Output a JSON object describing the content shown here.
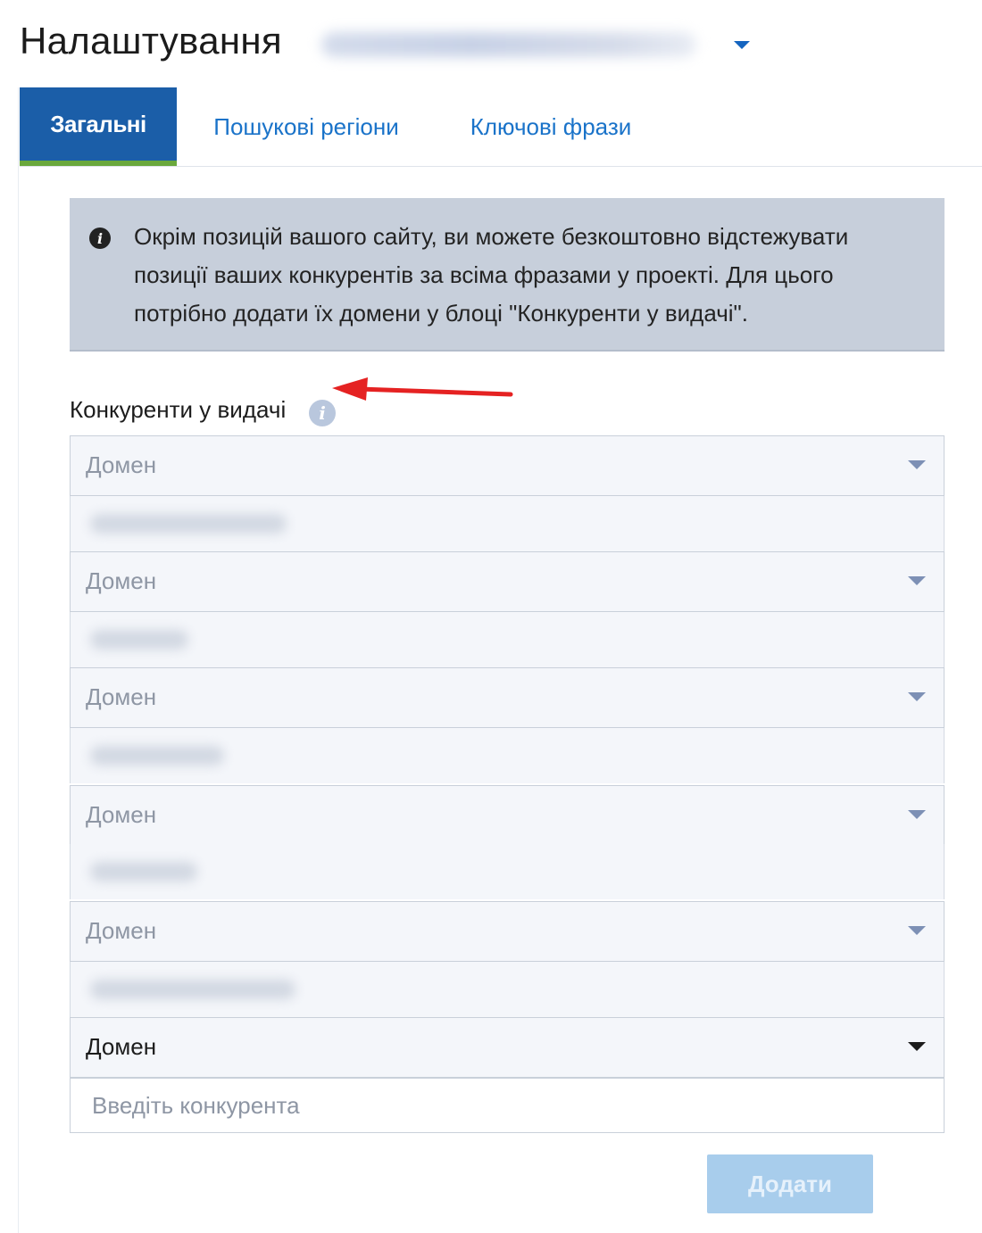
{
  "header": {
    "title": "Налаштування",
    "project_selector_icon": "caret-down-icon"
  },
  "tabs": [
    {
      "label": "Загальні",
      "active": true
    },
    {
      "label": "Пошукові регіони",
      "active": false
    },
    {
      "label": "Ключові фрази",
      "active": false
    }
  ],
  "info": {
    "icon": "info-icon",
    "text": "Окрім позицій вашого сайту, ви можете безкоштовно відстежувати позиції ваших конкурентів за всіма фразами у проекті. Для цього потрібно додати їх домени у блоці \"Конкуренти у видачі\"."
  },
  "competitors": {
    "label": "Конкуренти у видачі",
    "help_icon": "info-icon",
    "rows": [
      {
        "domain_placeholder": "Домен"
      },
      {
        "domain_placeholder": "Домен"
      },
      {
        "domain_placeholder": "Домен"
      },
      {
        "domain_placeholder": "Домен"
      },
      {
        "domain_placeholder": "Домен"
      }
    ],
    "new_row": {
      "domain_value": "Домен",
      "input_placeholder": "Введіть конкурента"
    },
    "add_label": "Додати"
  },
  "colors": {
    "brand": "#1b5ea8",
    "tab_accent": "#6aa83c",
    "link": "#1a73c9",
    "info_bg": "#c7cfdb",
    "annotation_arrow": "#e52222",
    "button_disabled": "#a8cdec"
  }
}
